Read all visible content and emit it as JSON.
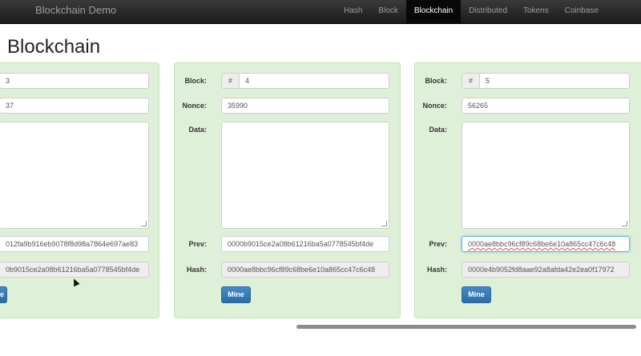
{
  "navbar": {
    "brand": "Blockchain Demo",
    "items": [
      {
        "label": "Hash",
        "active": false
      },
      {
        "label": "Block",
        "active": false
      },
      {
        "label": "Blockchain",
        "active": true
      },
      {
        "label": "Distributed",
        "active": false
      },
      {
        "label": "Tokens",
        "active": false
      },
      {
        "label": "Coinbase",
        "active": false
      }
    ]
  },
  "page": {
    "title": "Blockchain"
  },
  "labels": {
    "block": "Block:",
    "nonce": "Nonce:",
    "data": "Data:",
    "prev": "Prev:",
    "hash": "Hash:",
    "block_addon": "#"
  },
  "blocks": [
    {
      "number": "3",
      "nonce": "37",
      "data": "",
      "prev": "012fa9b916eb9078f8d98a7864e697ae83",
      "hash": "0b9015ce2a08b61216ba5a0778545bf4de",
      "mine_label": "ne"
    },
    {
      "number": "4",
      "nonce": "35990",
      "data": "",
      "prev": "0000b9015ce2a08b61216ba5a0778545bf4de",
      "hash": "0000ae8bbc96cf89c68be6e10a865cc47c6c48",
      "mine_label": "Mine"
    },
    {
      "number": "5",
      "nonce": "56265",
      "data": "",
      "prev": "0000ae8bbc96cf89c68be6e10a865cc47c6c48",
      "hash": "0000e4b9052fd8aae92a8afda42e2ea0f17972",
      "mine_label": "Mine"
    }
  ],
  "colors": {
    "panel_bg": "#dff0d8",
    "button": "#337ab7",
    "navbar": "#222222"
  }
}
